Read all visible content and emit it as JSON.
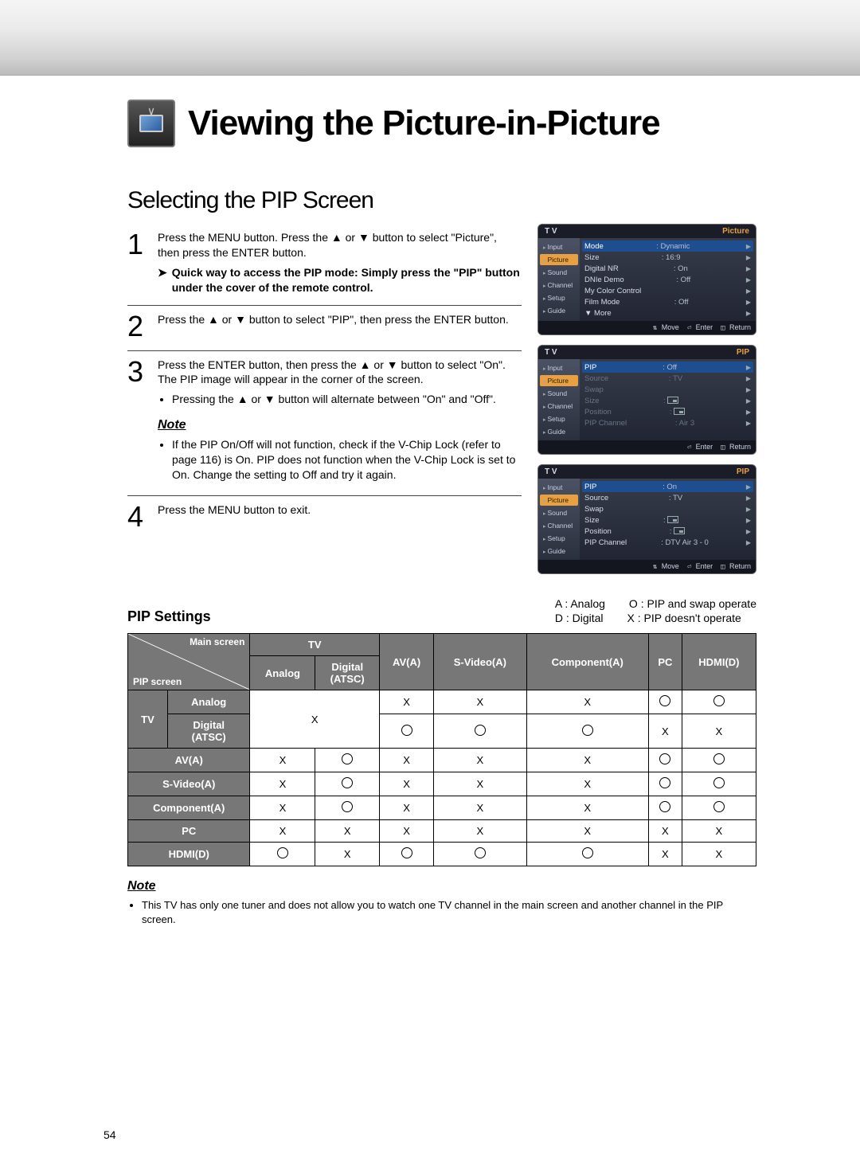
{
  "page_number": "54",
  "title_row": {
    "page_title": "Viewing the Picture-in-Picture"
  },
  "section_title": "Selecting the PIP Screen",
  "steps": [
    {
      "num": "1",
      "body": "Press the MENU button. Press the ▲ or ▼ button to select \"Picture\", then press the ENTER button.",
      "pointer": "Quick way to access the PIP mode: Simply press the \"PIP\" button under the cover of the remote control."
    },
    {
      "num": "2",
      "body": "Press the ▲ or ▼ button to select \"PIP\", then press the ENTER button."
    },
    {
      "num": "3",
      "body": "Press the ENTER button, then press the ▲ or ▼ button to select \"On\". The PIP image will appear in the corner of the screen.",
      "bullets": [
        "Pressing the ▲ or ▼ button will alternate between \"On\" and \"Off\"."
      ],
      "note_label": "Note",
      "note_bullets": [
        "If the PIP On/Off will not function, check if the V-Chip Lock (refer to page 116) is On. PIP does not function when the V-Chip Lock is set to On. Change the setting to Off and try it again."
      ]
    },
    {
      "num": "4",
      "body": "Press the MENU button to exit."
    }
  ],
  "osd_menus": [
    {
      "header_left": "T V",
      "header_title": "Picture",
      "nav": [
        "Input",
        "Picture",
        "Sound",
        "Channel",
        "Setup",
        "Guide"
      ],
      "nav_selected": 1,
      "rows": [
        {
          "label": "Mode",
          "value": ": Dynamic",
          "hl": true
        },
        {
          "label": "Size",
          "value": ": 16:9"
        },
        {
          "label": "Digital NR",
          "value": ": On"
        },
        {
          "label": "DNIe Demo",
          "value": ": Off"
        },
        {
          "label": "My Color Control",
          "value": ""
        },
        {
          "label": "Film Mode",
          "value": ": Off"
        },
        {
          "label": "▼ More",
          "value": ""
        }
      ],
      "footer": [
        "Move",
        "Enter",
        "Return"
      ]
    },
    {
      "header_left": "T V",
      "header_title": "PIP",
      "nav": [
        "Input",
        "Picture",
        "Sound",
        "Channel",
        "Setup",
        "Guide"
      ],
      "nav_selected": 1,
      "rows": [
        {
          "label": "PIP",
          "value": ": Off",
          "hl": true
        },
        {
          "label": "Source",
          "value": ": TV",
          "dim": true
        },
        {
          "label": "Swap",
          "value": "",
          "dim": true
        },
        {
          "label": "Size",
          "value": ": ⊡",
          "dim": true,
          "icon": "corner"
        },
        {
          "label": "Position",
          "value": ": ⊡",
          "dim": true,
          "icon": "corner"
        },
        {
          "label": "PIP Channel",
          "value": ": Air 3",
          "dim": true
        }
      ],
      "footer": [
        "Enter",
        "Return"
      ]
    },
    {
      "header_left": "T V",
      "header_title": "PIP",
      "nav": [
        "Input",
        "Picture",
        "Sound",
        "Channel",
        "Setup",
        "Guide"
      ],
      "nav_selected": 1,
      "rows": [
        {
          "label": "PIP",
          "value": ": On",
          "hl": true
        },
        {
          "label": "Source",
          "value": ": TV"
        },
        {
          "label": "Swap",
          "value": ""
        },
        {
          "label": "Size",
          "value": ": ⊡",
          "icon": "corner"
        },
        {
          "label": "Position",
          "value": ": ⊡",
          "icon": "corner"
        },
        {
          "label": "PIP Channel",
          "value": ": DTV Air 3 - 0"
        }
      ],
      "footer": [
        "Move",
        "Enter",
        "Return"
      ]
    }
  ],
  "settings": {
    "title": "PIP Settings",
    "legend_a": "A : Analog",
    "legend_d": "D : Digital",
    "legend_o": "O : PIP and swap operate",
    "legend_x": "X : PIP doesn't operate",
    "diag_top": "Main screen",
    "diag_bot": "PIP screen",
    "columns": [
      "TV",
      "AV(A)",
      "S-Video(A)",
      "Component(A)",
      "PC",
      "HDMI(D)"
    ],
    "tv_sub": [
      "Analog",
      "Digital\n(ATSC)"
    ],
    "rows": [
      {
        "head": "TV",
        "sub": "Analog"
      },
      {
        "head": "",
        "sub": "Digital\n(ATSC)"
      },
      {
        "head": "AV(A)"
      },
      {
        "head": "S-Video(A)"
      },
      {
        "head": "Component(A)"
      },
      {
        "head": "PC"
      },
      {
        "head": "HDMI(D)"
      }
    ],
    "grid": [
      [
        null,
        null,
        "X",
        "X",
        "X",
        "O",
        "O"
      ],
      [
        "X_span",
        null,
        "O",
        "O",
        "O",
        "X",
        "X"
      ],
      [
        "X",
        "O",
        "X",
        "X",
        "X",
        "O",
        "O"
      ],
      [
        "X",
        "O",
        "X",
        "X",
        "X",
        "O",
        "O"
      ],
      [
        "X",
        "O",
        "X",
        "X",
        "X",
        "O",
        "O"
      ],
      [
        "X",
        "X",
        "X",
        "X",
        "X",
        "X",
        "X"
      ],
      [
        "O",
        "X",
        "O",
        "O",
        "O",
        "X",
        "X"
      ]
    ]
  },
  "footer_note": {
    "note_label": "Note",
    "text": "This TV has only one tuner and does not allow you to watch one TV channel in the main screen and another channel in the PIP screen."
  }
}
